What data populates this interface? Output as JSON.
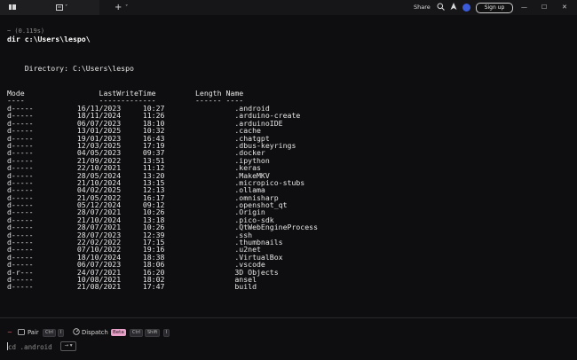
{
  "titlebar": {
    "menu_icon": "app-logo-icon",
    "tab_icon": "terminal-tab-icon",
    "tab_chevron": "˅",
    "new_tab_label": "+",
    "new_tab_chevron": "˅",
    "share_label": "Share",
    "signup_label": "Sign up",
    "minimize": "—",
    "maximize": "☐",
    "close": "✕"
  },
  "terminal": {
    "timing": "~ (0.119s)",
    "command": "dir c:\\Users\\lespo\\",
    "directory_line": "    Directory: C:\\Users\\lespo",
    "header": "Mode                 LastWriteTime         Length Name",
    "separator": "----                 -------------         ------ ----",
    "rows": [
      {
        "mode": "d-----",
        "date": "16/11/2023",
        "time": "10:27",
        "name": ".android"
      },
      {
        "mode": "d-----",
        "date": "18/11/2024",
        "time": "11:26",
        "name": ".arduino-create"
      },
      {
        "mode": "d-----",
        "date": "06/07/2023",
        "time": "18:10",
        "name": ".arduinoIDE"
      },
      {
        "mode": "d-----",
        "date": "13/01/2025",
        "time": "10:32",
        "name": ".cache"
      },
      {
        "mode": "d-----",
        "date": "19/01/2023",
        "time": "16:43",
        "name": ".chatgpt"
      },
      {
        "mode": "d-----",
        "date": "12/03/2025",
        "time": "17:19",
        "name": ".dbus-keyrings"
      },
      {
        "mode": "d-----",
        "date": "04/05/2023",
        "time": "09:37",
        "name": ".docker"
      },
      {
        "mode": "d-----",
        "date": "21/09/2022",
        "time": "13:51",
        "name": ".ipython"
      },
      {
        "mode": "d-----",
        "date": "22/10/2021",
        "time": "11:12",
        "name": ".keras"
      },
      {
        "mode": "d-----",
        "date": "28/05/2024",
        "time": "13:20",
        "name": ".MakeMKV"
      },
      {
        "mode": "d-----",
        "date": "21/10/2024",
        "time": "13:15",
        "name": ".micropico-stubs"
      },
      {
        "mode": "d-----",
        "date": "04/02/2025",
        "time": "12:13",
        "name": ".ollama"
      },
      {
        "mode": "d-----",
        "date": "21/05/2022",
        "time": "16:17",
        "name": ".omnisharp"
      },
      {
        "mode": "d-----",
        "date": "05/12/2024",
        "time": "09:12",
        "name": ".openshot_qt"
      },
      {
        "mode": "d-----",
        "date": "28/07/2021",
        "time": "10:26",
        "name": ".Origin"
      },
      {
        "mode": "d-----",
        "date": "21/10/2024",
        "time": "13:18",
        "name": ".pico-sdk"
      },
      {
        "mode": "d-----",
        "date": "28/07/2021",
        "time": "10:26",
        "name": ".QtWebEngineProcess"
      },
      {
        "mode": "d-----",
        "date": "28/07/2023",
        "time": "12:39",
        "name": ".ssh"
      },
      {
        "mode": "d-----",
        "date": "22/02/2022",
        "time": "17:15",
        "name": ".thumbnails"
      },
      {
        "mode": "d-----",
        "date": "07/10/2022",
        "time": "19:16",
        "name": ".u2net"
      },
      {
        "mode": "d-----",
        "date": "18/10/2024",
        "time": "18:38",
        "name": ".VirtualBox"
      },
      {
        "mode": "d-----",
        "date": "06/07/2023",
        "time": "18:06",
        "name": ".vscode"
      },
      {
        "mode": "d-r---",
        "date": "24/07/2021",
        "time": "16:20",
        "name": "3D Objects"
      },
      {
        "mode": "d-----",
        "date": "10/08/2021",
        "time": "18:02",
        "name": "ansel"
      },
      {
        "mode": "d-----",
        "date": "21/08/2021",
        "time": "17:47",
        "name": "build"
      }
    ]
  },
  "bottom": {
    "pair_label": "Pair",
    "pair_key1": "Ctrl",
    "pair_key2": "I",
    "dispatch_label": "Dispatch",
    "beta_label": "Beta",
    "dispatch_key1": "Ctrl",
    "dispatch_key2": "Shift",
    "dispatch_key3": "I",
    "input_value": "cd .android",
    "chip_label": "→ ▾"
  },
  "colors": {
    "background": "#0e0e10",
    "accent_avatar": "#3b5bdb",
    "beta_badge": "#e8a0c8",
    "pair_icon": "#e05a6a"
  }
}
